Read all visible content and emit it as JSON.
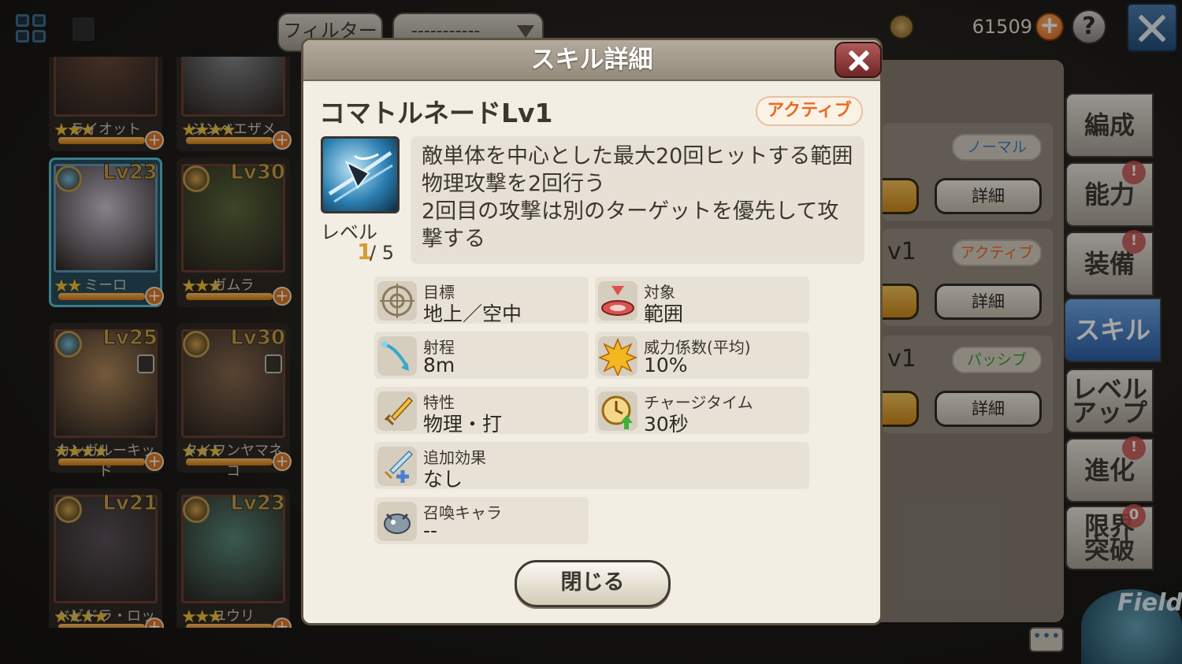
{
  "topbar": {
    "filter_label": "フィルター",
    "select_value": "-----------",
    "currency": "61509",
    "help": "?"
  },
  "characters": [
    {
      "name": "ライオット",
      "stars": "★★★",
      "level": ""
    },
    {
      "name": "ジンベエザメ",
      "stars": "★★★★",
      "level": ""
    },
    {
      "name": "ミーロ",
      "stars": "★★",
      "level": "Lv23",
      "selected": true
    },
    {
      "name": "ガムラ",
      "stars": "★★★",
      "level": "Lv30"
    },
    {
      "name": "カンガルーキッド",
      "stars": "★★★★",
      "level": "Lv25"
    },
    {
      "name": "タイワンヤマネコ",
      "stars": "★★★",
      "level": "Lv30"
    },
    {
      "name": "ベビドラ・ロッカ",
      "stars": "★★★★",
      "level": "Lv21"
    },
    {
      "name": "ユウリ",
      "stars": "★★★",
      "level": "Lv23"
    }
  ],
  "right_panel": {
    "sections": [
      {
        "badge": "ノーマル",
        "badge_color": "#3d7fc4",
        "lv": "",
        "detail": "詳細"
      },
      {
        "badge": "アクティブ",
        "badge_color": "#ea6a22",
        "lv": "v1",
        "detail": "詳細"
      },
      {
        "badge": "パッシブ",
        "badge_color": "#3d9a3a",
        "lv": "v1",
        "detail": "詳細"
      }
    ]
  },
  "side_tabs": [
    {
      "label": "編成",
      "badge": ""
    },
    {
      "label": "能力",
      "badge": "!"
    },
    {
      "label": "装備",
      "badge": "!"
    },
    {
      "label": "スキル",
      "badge": "",
      "active": true
    },
    {
      "label": "レベル\nアップ",
      "badge": ""
    },
    {
      "label": "進化",
      "badge": "!"
    },
    {
      "label": "限界\n突破",
      "badge": "0"
    }
  ],
  "field": {
    "label": "Field"
  },
  "modal": {
    "title": "スキル詳細",
    "skill_name": "コマトルネードLv1",
    "skill_type": "アクティブ",
    "level_label": "レベル",
    "level_current": "1",
    "level_max": "/ 5",
    "description": "敵単体を中心とした最大20回ヒットする範囲物理攻撃を2回行う\n2回目の攻撃は別のターゲットを優先して攻撃する",
    "stats": [
      {
        "label": "目標",
        "value": "地上／空中",
        "icon": "target-icon"
      },
      {
        "label": "対象",
        "value": "範囲",
        "icon": "area-icon"
      },
      {
        "label": "射程",
        "value": "8m",
        "icon": "range-arrow-icon"
      },
      {
        "label": "威力係数(平均)",
        "value": "10%",
        "icon": "burst-icon"
      },
      {
        "label": "特性",
        "value": "物理・打",
        "icon": "sword-icon"
      },
      {
        "label": "チャージタイム",
        "value": "30秒",
        "icon": "clock-icon"
      },
      {
        "label": "追加効果",
        "value": "なし",
        "icon": "sword-plus-icon"
      },
      {
        "label": "召喚キャラ",
        "value": "--",
        "icon": "summon-icon"
      }
    ],
    "close_label": "閉じる"
  },
  "colors": {
    "accent_orange": "#ea6a22",
    "active_tab": "#2d5fa5",
    "level_gold": "#d89b2f"
  }
}
